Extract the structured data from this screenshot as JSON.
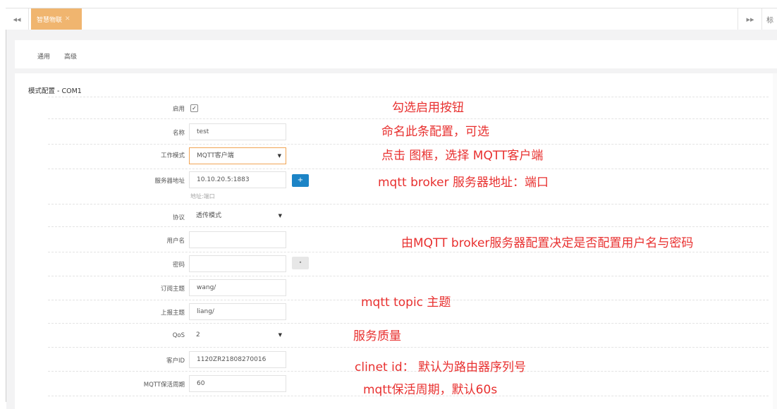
{
  "topbar": {
    "nav_prev_icon": "double-left-arrow-icon",
    "nav_prev_glyph": "◂◂",
    "active_tab_label": "智慧物联",
    "active_tab_close_glyph": "✕",
    "nav_next_icon": "double-right-arrow-icon",
    "nav_next_glyph": "▸▸",
    "more_glyph": "标"
  },
  "subtabs": {
    "general": "通用",
    "advanced": "高级"
  },
  "form": {
    "section_title": "模式配置 - COM1",
    "enable": {
      "label": "启用",
      "checked": true,
      "check_glyph": "✓"
    },
    "name": {
      "label": "名称",
      "value": "test"
    },
    "work_mode": {
      "label": "工作模式",
      "value": "MQTT客户端"
    },
    "server_address": {
      "label": "服务器地址",
      "value": "10.10.20.5:1883",
      "hint": "地址:端口",
      "add_glyph": "+"
    },
    "protocol": {
      "label": "协议",
      "value": "透传模式"
    },
    "username": {
      "label": "用户名",
      "value": ""
    },
    "password": {
      "label": "密码",
      "value": "",
      "eye_glyph": "•"
    },
    "subscribe_topic": {
      "label": "订阅主题",
      "value": "wang/"
    },
    "publish_topic": {
      "label": "上报主题",
      "value": "liang/"
    },
    "qos": {
      "label": "QoS",
      "value": "2"
    },
    "client_id": {
      "label": "客户ID",
      "value": "1120ZR21808270016"
    },
    "keepalive": {
      "label": "MQTT保活周期",
      "value": "60"
    }
  },
  "annotations": {
    "enable": "勾选启用按钮",
    "name": "命名此条配置，可选",
    "work_mode": "点击 图框，选择 MQTT客户端",
    "server": "mqtt broker 服务器地址：端口",
    "auth": "由MQTT broker服务器配置决定是否配置用户名与密码",
    "topic": "mqtt topic 主题",
    "qos": "服务质量",
    "client_id": "clinet id： 默认为路由器序列号",
    "keepalive": "mqtt保活周期，默认60s"
  },
  "colors": {
    "accent": "#f0b56f",
    "primary_button": "#1c84c6",
    "annotation_text": "#e8302f"
  }
}
